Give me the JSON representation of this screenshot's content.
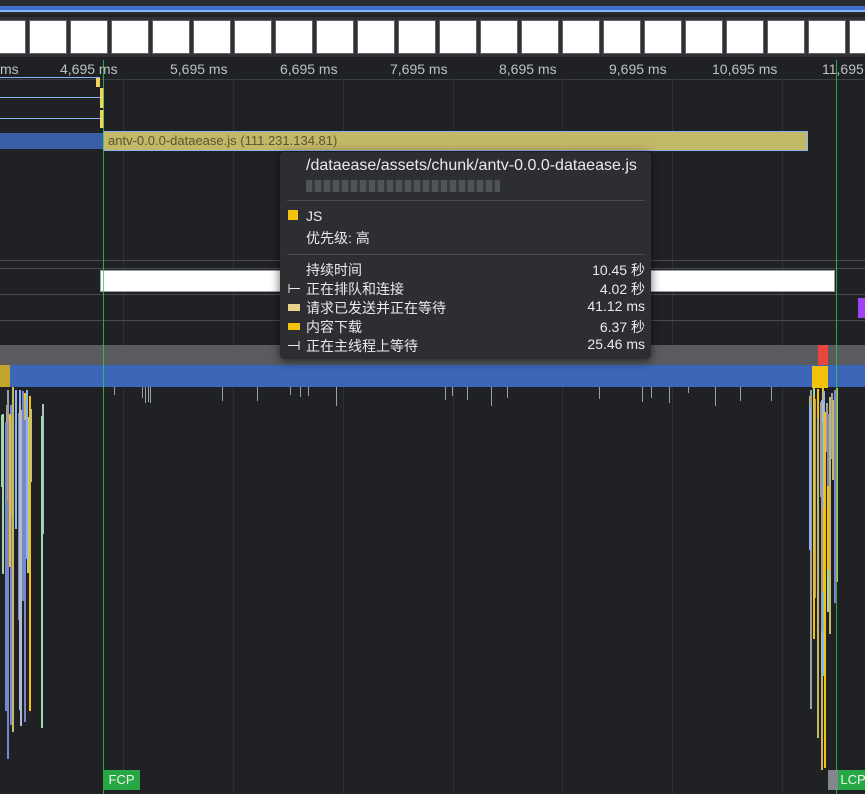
{
  "ruler": {
    "ticks": [
      "ms",
      "4,695 ms",
      "5,695 ms",
      "6,695 ms",
      "7,695 ms",
      "8,695 ms",
      "9,695 ms",
      "10,695 ms",
      "11,695"
    ]
  },
  "network": {
    "request_label": "antv-0.0.0-dataease.js (111.231.134.81)"
  },
  "markers": {
    "fcp": "FCP",
    "lcp": "LCP"
  },
  "tooltip": {
    "url": "/dataease/assets/chunk/antv-0.0.0-dataease.js",
    "type": "JS",
    "priority": "优先级: 高",
    "rows": [
      {
        "label": "持续时间",
        "value": "10.45 秒"
      },
      {
        "label": "正在排队和连接",
        "value": "4.02 秒"
      },
      {
        "label": "请求已发送并正在等待",
        "value": "41.12 ms"
      },
      {
        "label": "内容下载",
        "value": "6.37 秒"
      },
      {
        "label": "正在主线程上等待",
        "value": "25.46 ms"
      }
    ],
    "colors": {
      "js": "#f4c20d",
      "waiting": "#e8d28a",
      "download": "#f4c20d"
    }
  },
  "colors": {
    "background": "#202124",
    "network_bar": "#c3b768",
    "main_thread": "#3c67b8",
    "marker": "#34c759"
  }
}
